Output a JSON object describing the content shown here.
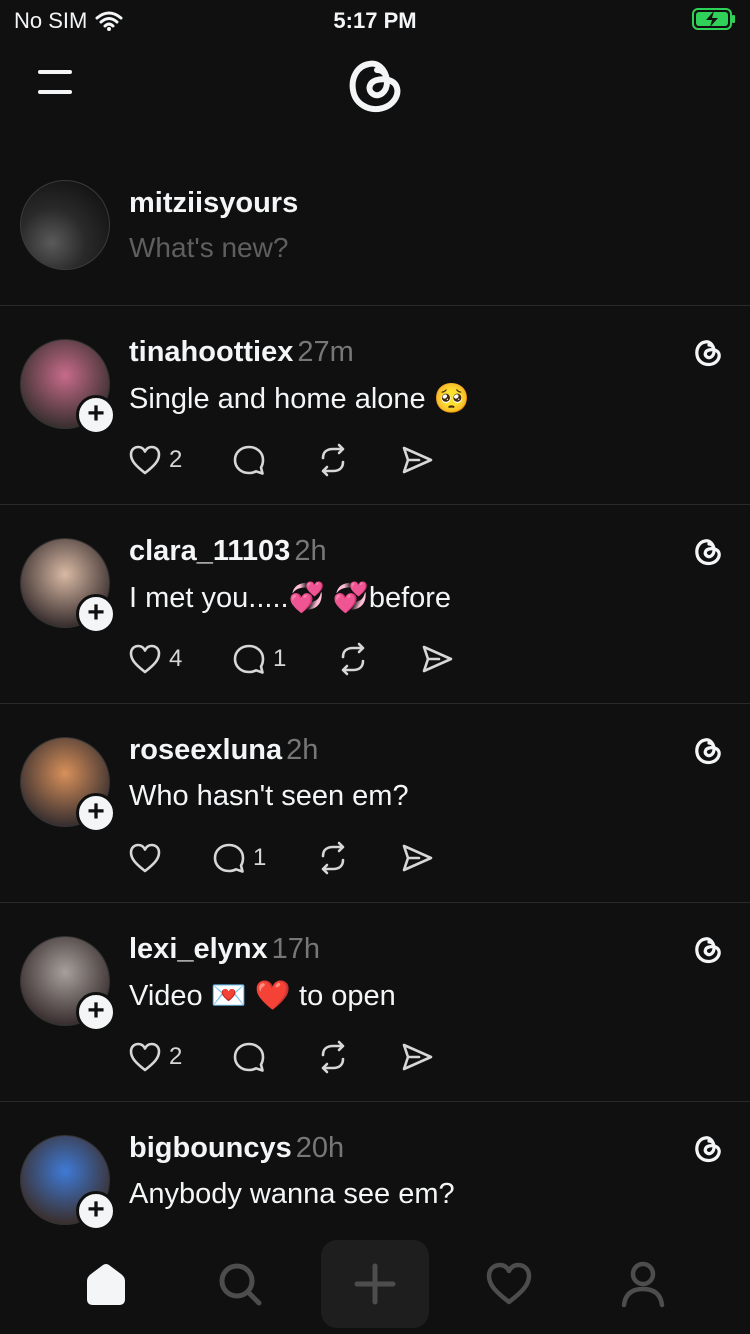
{
  "status_bar": {
    "carrier": "No SIM",
    "time": "5:17 PM",
    "battery_color": "#30d158"
  },
  "composer": {
    "username": "mitziisyours",
    "placeholder": "What's new?"
  },
  "posts": [
    {
      "username": "tinahoottiex",
      "time": "27m",
      "text": "Single and home alone 🥺",
      "likes": "2",
      "replies": "",
      "avatar_color": "#c76b8a"
    },
    {
      "username": "clara_11103",
      "time": "2h",
      "text": "I met you.....💞 💞before",
      "likes": "4",
      "replies": "1",
      "avatar_color": "#d9b9a4"
    },
    {
      "username": "roseexluna",
      "time": "2h",
      "text": "Who hasn't seen em?",
      "likes": "",
      "replies": "1",
      "avatar_color": "#d8905a"
    },
    {
      "username": "lexi_elynx",
      "time": "17h",
      "text": "Video 💌 ❤️ to open",
      "likes": "2",
      "replies": "",
      "avatar_color": "#a6a09b"
    },
    {
      "username": "bigbouncys",
      "time": "20h",
      "text": "Anybody wanna see em?",
      "likes": "",
      "replies": "",
      "avatar_color": "#3f7ad6"
    }
  ],
  "tabs": [
    {
      "name": "home",
      "icon": "home-icon",
      "active": true
    },
    {
      "name": "search",
      "icon": "search-icon"
    },
    {
      "name": "create",
      "icon": "plus-icon"
    },
    {
      "name": "activity",
      "icon": "heart-icon"
    },
    {
      "name": "profile",
      "icon": "person-icon"
    }
  ]
}
